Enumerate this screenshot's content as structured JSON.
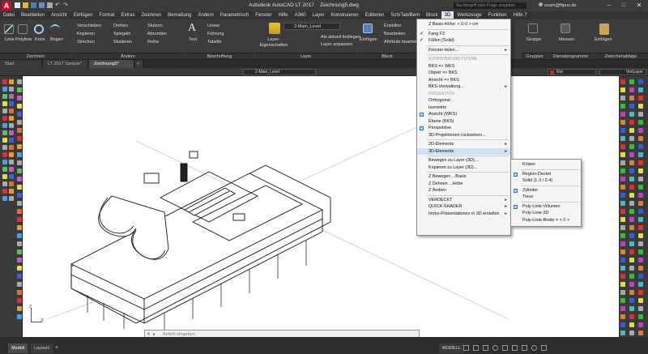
{
  "title": {
    "app": "Autodesk AutoCAD LT 2017",
    "file": "Zeichnung5.dwg",
    "search_placeholder": "Suchbegriff oder Frage eingeben",
    "user": "exam@flipus.de"
  },
  "menubar": [
    "Datei",
    "Bearbeiten",
    "Ansicht",
    "Einfügen",
    "Format",
    "Extras",
    "Zeichnen",
    "Bemaßung",
    "Ändern",
    "Parametrisch",
    "Fenster",
    "Hilfe",
    "A360",
    "Layer",
    "Konstruieren",
    "Editieren",
    "Sch/Tab/Bem",
    "Block",
    "3D",
    "Werkzeuge",
    "Funktion",
    "Hilfe 7"
  ],
  "ribbon": {
    "draw_tools": [
      "Linie",
      "Polylinie",
      "Kreis",
      "Bogen"
    ],
    "modify_tools": [
      "Verschieben",
      "Kopieren",
      "Strecken",
      "Drehen",
      "Spiegeln",
      "Skalieren",
      "Stutzen",
      "Abrunden",
      "Reihe"
    ],
    "text": "Text",
    "dim_tools": [
      "Linear",
      "Führung",
      "Tabelle"
    ],
    "layer_props": "Layer-Eigenschaften",
    "layer_current": "2-Main_Level",
    "layer_tools": [
      "Als aktuell festlegen",
      "Layer anpassen"
    ],
    "insert": "Einfügen",
    "block_tools": [
      "Erstellen",
      "Bearbeiten",
      "Attribute bearbeiten"
    ],
    "right_tools": [
      "Gruppe",
      "Messen",
      "Einfügen"
    ],
    "panels": [
      "Zeichnen",
      "Ändern",
      "Beschriftung",
      "Layer",
      "Block",
      "Gruppen",
      "Dienstprogramme",
      "Zwischenablage"
    ]
  },
  "doctabs": [
    "Start",
    "LT 2017 Sample*",
    "Zeichnung5*"
  ],
  "propbar": {
    "layer": "2-Main_Level",
    "color": "Rot",
    "linetype": "VonLayer"
  },
  "menu3d": {
    "items": [
      {
        "label": "Z Basis-Höhe: < 0-0 > cm"
      },
      {
        "sep": true
      },
      {
        "label": "Fang   F3",
        "check": true
      },
      {
        "label": "Füllen (Solid)",
        "check": true
      },
      {
        "sep": true
      },
      {
        "label": "Fenster teilen...",
        "arrow": true
      },
      {
        "sep": true
      },
      {
        "label": "KOORDINATENSYSTEME",
        "section": true
      },
      {
        "label": "BKS        => WKS"
      },
      {
        "label": "Objekt   => BKS"
      },
      {
        "label": "Ansicht => BKS"
      },
      {
        "label": "BKS-Verwaltung...",
        "arrow": true
      },
      {
        "label": "PROJEKTION",
        "section": true
      },
      {
        "label": "Orthogonal"
      },
      {
        "label": "Isometrie"
      },
      {
        "label": "Ansicht (WKS)",
        "icon": true
      },
      {
        "label": "Ebene (BKS)"
      },
      {
        "label": "Perspektive",
        "icon": true
      },
      {
        "label": "3D-Projektionen rücksetzen..."
      },
      {
        "sep": true
      },
      {
        "label": "2D-Elemente",
        "arrow": true
      },
      {
        "label": "3D-Elemente",
        "arrow": true,
        "highlight": true
      },
      {
        "sep": true
      },
      {
        "label": "Bewegen zu Layer (3D)..."
      },
      {
        "label": "Kopieren  zu Layer (3D)..."
      },
      {
        "sep": true
      },
      {
        "label": "Z Bewegen    ...Basis"
      },
      {
        "label": "Z Dehnen     ...Höhe"
      },
      {
        "label": "Z Ändern"
      },
      {
        "sep": true
      },
      {
        "label": "VERDECKT",
        "arrow": true
      },
      {
        "label": "QUICK-SHADER",
        "arrow": true
      },
      {
        "label": "Immo-Präsentationen in 3D erstellen",
        "arrow": true
      }
    ]
  },
  "submenu": {
    "items": [
      {
        "label": "Körper"
      },
      {
        "sep": true
      },
      {
        "label": "Region-Deckel",
        "icon": true
      },
      {
        "label": "Solid (1-3 / 2-4)"
      },
      {
        "sep": true
      },
      {
        "label": "Zylinder",
        "icon": true
      },
      {
        "label": "Torus"
      },
      {
        "sep": true
      },
      {
        "label": "Poly-Linie-Volumen",
        "icon": true
      },
      {
        "label": "Poly-Linie-3D"
      },
      {
        "label": "Poly-Linie-Breite = < 0 >"
      }
    ]
  },
  "status": {
    "model": "MODELL",
    "layout_tabs": [
      "Modell",
      "Layout1"
    ],
    "cmd_placeholder": "Befehl eingeben"
  },
  "colors": {
    "accent": "#dce7f5",
    "highlight": "#cfe0f5",
    "canvas": "#ffffff",
    "chrome": "#3c3c3c"
  }
}
